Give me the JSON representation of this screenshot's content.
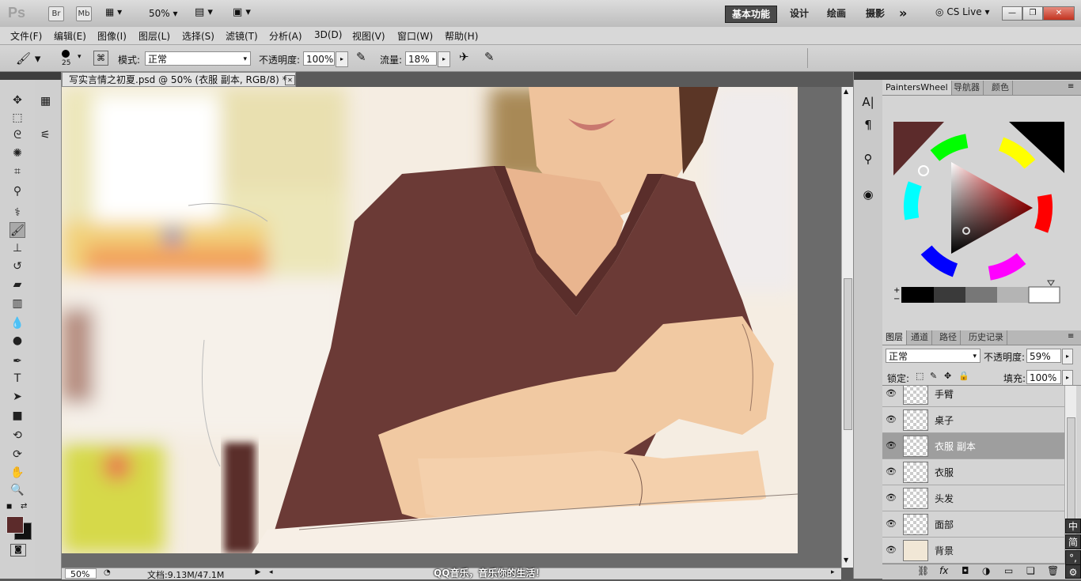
{
  "appbar": {
    "logo": "Ps",
    "bridge": "Br",
    "minibridge": "Mb",
    "zoom": "50%",
    "workspaces": [
      "基本功能",
      "设计",
      "绘画",
      "摄影"
    ],
    "more": "»",
    "cslive": "CS Live",
    "min": "—",
    "restore": "❐",
    "close": "✕"
  },
  "menus": [
    "文件(F)",
    "编辑(E)",
    "图像(I)",
    "图层(L)",
    "选择(S)",
    "滤镜(T)",
    "分析(A)",
    "3D(D)",
    "视图(V)",
    "窗口(W)",
    "帮助(H)"
  ],
  "options": {
    "brush_size": "25",
    "mode_label": "模式:",
    "mode_value": "正常",
    "opacity_label": "不透明度:",
    "opacity_value": "100%",
    "flow_label": "流量:",
    "flow_value": "18%"
  },
  "document": {
    "tab_title": "写实言情之初夏.psd @ 50% (衣服 副本, RGB/8) *",
    "tab_close": "✕",
    "status_zoom": "50%",
    "status_doc": "文档:9.13M/47.1M",
    "status_arrow": "▶",
    "caption": "QQ音乐，音乐你的生活！"
  },
  "colors": {
    "foreground": "#5c2b2b",
    "background": "#111111",
    "accent": "#4a4a4a",
    "selected_layer": "#9e9e9e"
  },
  "panels_top": {
    "tabs": [
      "PaintersWheel",
      "导航器",
      "颜色"
    ]
  },
  "layers_panel": {
    "tabs": [
      "图层",
      "通道",
      "路径",
      "历史记录"
    ],
    "blend_mode": "正常",
    "opacity_label": "不透明度:",
    "opacity_value": "59%",
    "lock_label": "锁定:",
    "fill_label": "填充:",
    "fill_value": "100%",
    "layers": [
      {
        "name": "手臂",
        "selected": false
      },
      {
        "name": "桌子",
        "selected": false
      },
      {
        "name": "衣服 副本",
        "selected": true
      },
      {
        "name": "衣服",
        "selected": false
      },
      {
        "name": "头发",
        "selected": false
      },
      {
        "name": "面部",
        "selected": false
      },
      {
        "name": "背景",
        "selected": false
      }
    ]
  },
  "ime": [
    "中",
    "简",
    "°,"
  ]
}
